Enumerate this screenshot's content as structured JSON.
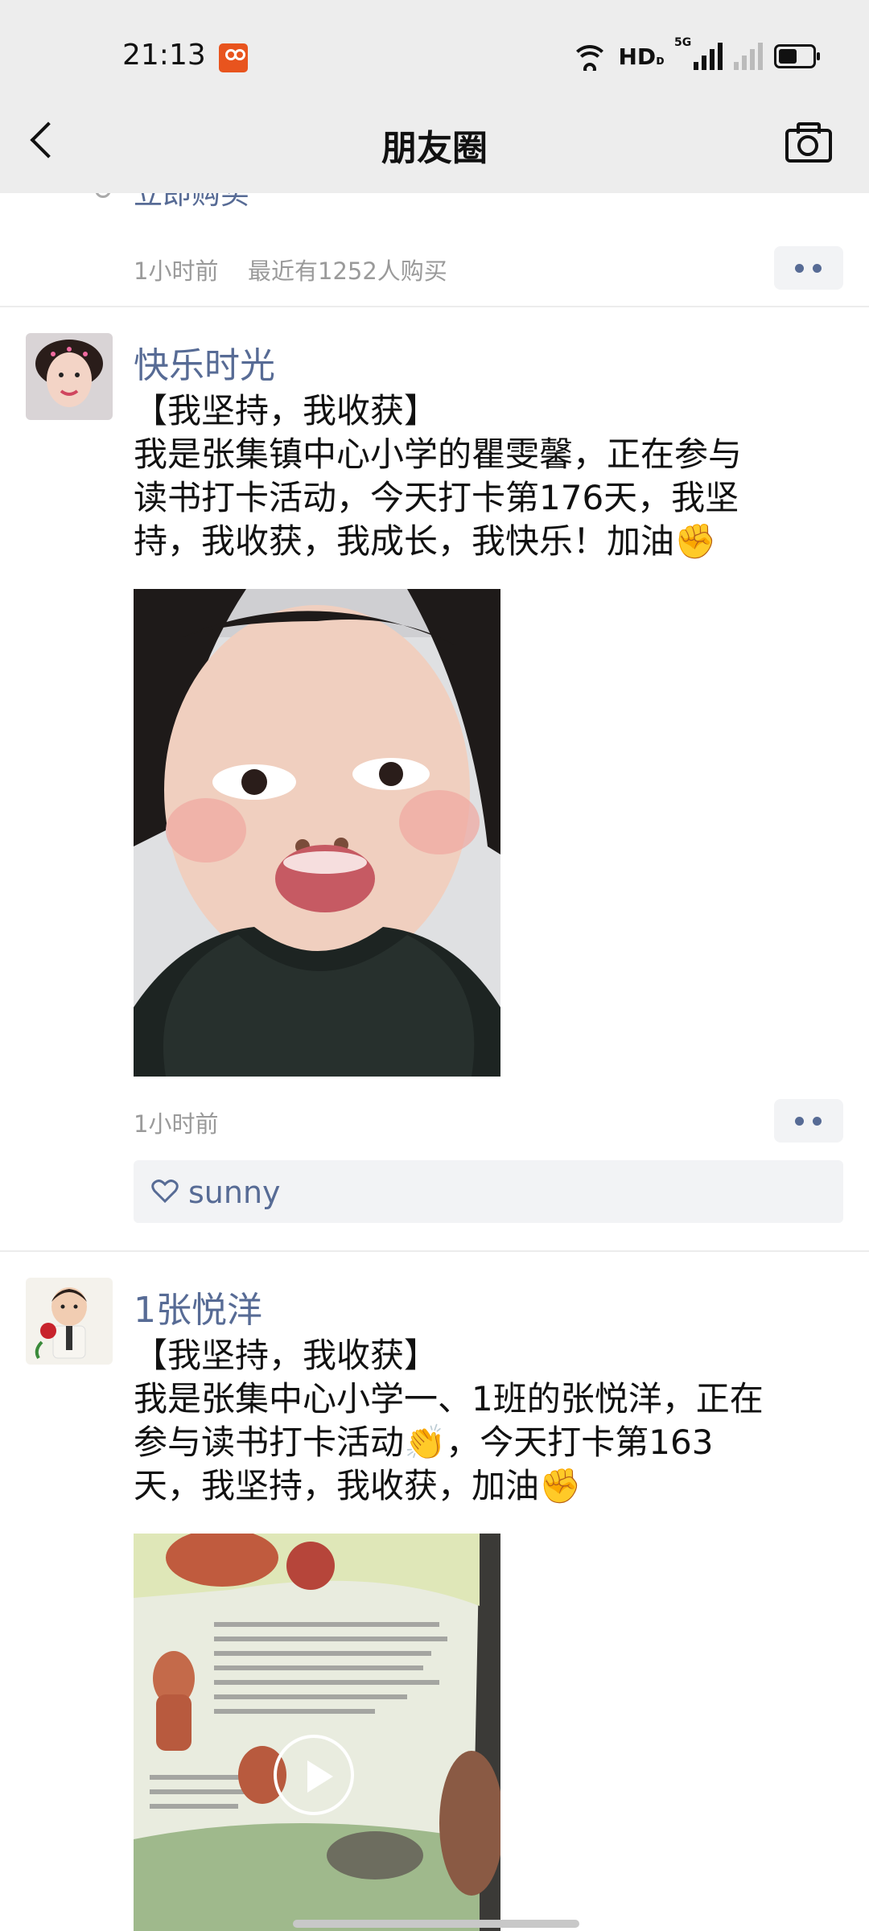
{
  "status_bar": {
    "time": "21:13",
    "network_label": "HD",
    "network_sub": "ᴅ",
    "signal_label": "5G",
    "icons": [
      "app-notification-icon",
      "wifi-icon",
      "hd-icon",
      "5g-signal-icon",
      "no-signal-icon",
      "battery-icon"
    ]
  },
  "nav": {
    "title": "朋友圈",
    "back_icon": "back-arrow-icon",
    "camera_icon": "camera-icon"
  },
  "feed": {
    "previous_post": {
      "link_text": "立即购买",
      "time": "1小时前",
      "purchase_note": "最近有1252人购买"
    },
    "posts": [
      {
        "author": "快乐时光",
        "text_lines": [
          "【我坚持，我收获】",
          "我是张集镇中心小学的瞿雯馨，正在参与",
          "读书打卡活动，今天打卡第176天，我坚",
          "持，我收获，我成长，我快乐！加油✊"
        ],
        "time": "1小时前",
        "likes": [
          "sunny"
        ],
        "media": "photo"
      },
      {
        "author": "1张悦洋",
        "text_lines": [
          "【我坚持，我收获】",
          "我是张集中心小学一、1班的张悦洋，正在",
          "参与读书打卡活动👏，今天打卡第163",
          "天，我坚持，我收获，加油✊"
        ],
        "media": "video"
      }
    ]
  },
  "colors": {
    "link_blue": "#576b95",
    "meta_gray": "#9a9a9a",
    "top_bar": "#ededed",
    "panel_bg": "#f2f3f5"
  }
}
